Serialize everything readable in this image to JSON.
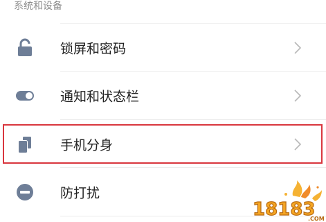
{
  "section": {
    "title": "系统和设备"
  },
  "items": [
    {
      "label": "锁屏和密码",
      "icon": "lock-icon"
    },
    {
      "label": "通知和状态栏",
      "icon": "toggle-icon"
    },
    {
      "label": "手机分身",
      "icon": "second-space-icon"
    },
    {
      "label": "防打扰",
      "icon": "do-not-disturb-icon"
    }
  ],
  "watermark": {
    "text": "18183",
    "suffix": ".COM"
  },
  "colors": {
    "icon": "#6e7e97",
    "highlight_border": "#d9363e",
    "divider": "#ececec",
    "label": "#222222",
    "header": "#8c8c8c",
    "chevron": "#b8b8b8"
  }
}
